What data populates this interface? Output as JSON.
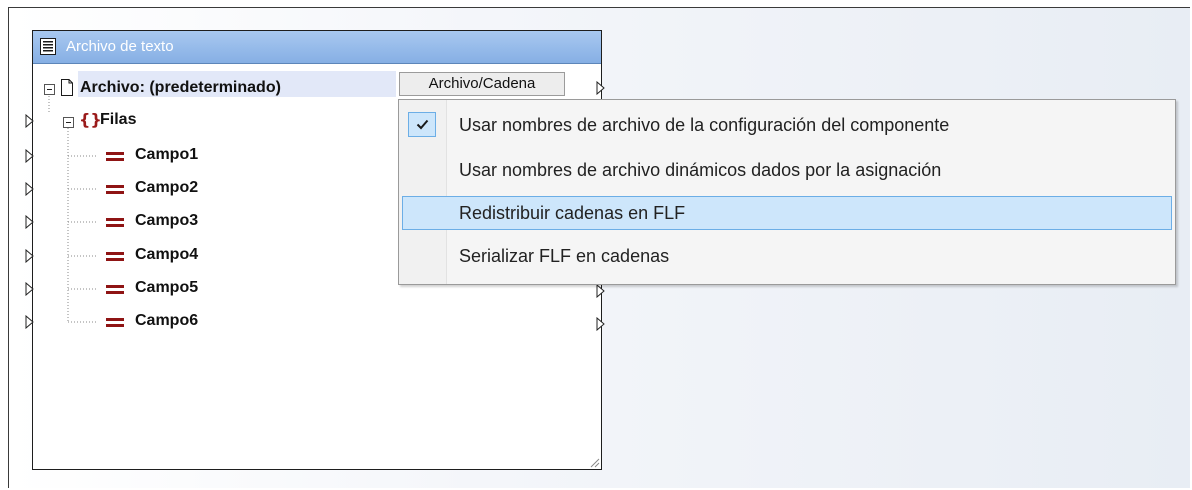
{
  "component": {
    "title": "Archivo de texto",
    "icon": "text-file-component-icon",
    "root": {
      "label": "Archivo: (predeterminado)",
      "mode_button": "Archivo/Cadena",
      "icon": "file-icon"
    },
    "rows_node": {
      "label": "Filas",
      "icon": "braces-icon"
    },
    "fields": [
      {
        "label": "Campo1",
        "icon": "field-icon"
      },
      {
        "label": "Campo2",
        "icon": "field-icon"
      },
      {
        "label": "Campo3",
        "icon": "field-icon"
      },
      {
        "label": "Campo4",
        "icon": "field-icon"
      },
      {
        "label": "Campo5",
        "icon": "field-icon"
      },
      {
        "label": "Campo6",
        "icon": "field-icon"
      }
    ]
  },
  "context_menu": {
    "items": [
      {
        "label": "Usar nombres de archivo de la configuración del componente",
        "checked": true,
        "highlighted": false
      },
      {
        "label": "Usar nombres de archivo dinámicos dados por la asignación",
        "checked": false,
        "highlighted": false
      },
      {
        "label": "Redistribuir cadenas en FLF",
        "checked": false,
        "highlighted": true
      },
      {
        "label": "Serializar FLF en cadenas",
        "checked": false,
        "highlighted": false
      }
    ]
  },
  "colors": {
    "header_gradient_top": "#a8c8f0",
    "header_gradient_bottom": "#86afe4",
    "field_icon": "#8f1414",
    "menu_highlight": "#cde6fb",
    "menu_highlight_border": "#6caee6"
  }
}
